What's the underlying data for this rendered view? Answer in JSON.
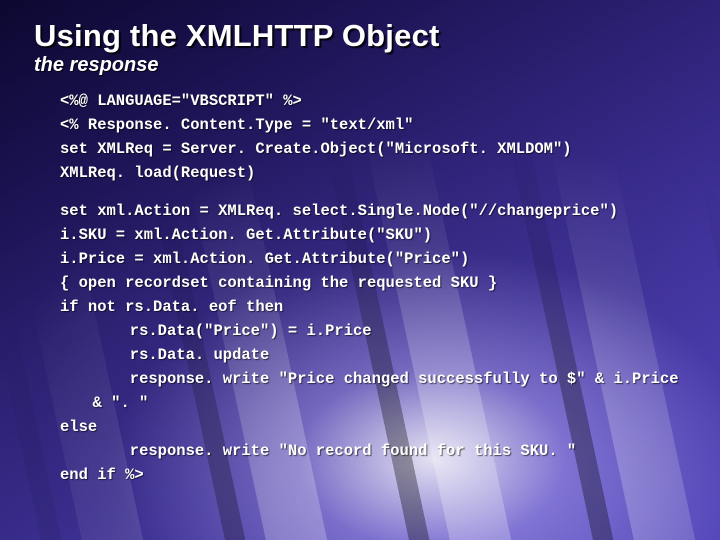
{
  "title": "Using the XMLHTTP Object",
  "subtitle": "the response",
  "block1": [
    "<%@ LANGUAGE=\"VBSCRIPT\" %>",
    "<% Response. Content.Type = \"text/xml\"",
    "set XMLReq = Server. Create.Object(\"Microsoft. XMLDOM\")",
    "XMLReq. load(Request)"
  ],
  "block2": [
    "set xml.Action = XMLReq. select.Single.Node(\"//changeprice\")",
    "i.SKU = xml.Action. Get.Attribute(\"SKU\")",
    "i.Price = xml.Action. Get.Attribute(\"Price\")",
    "{ open recordset containing the requested SKU }",
    "if not rs.Data. eof then",
    "    rs.Data(\"Price\") = i.Price",
    "    rs.Data. update",
    "    response. write \"Price changed successfully to $\" & i.Price & \". \"",
    "else",
    "    response. write \"No record found for this SKU. \"",
    "end if %>"
  ]
}
